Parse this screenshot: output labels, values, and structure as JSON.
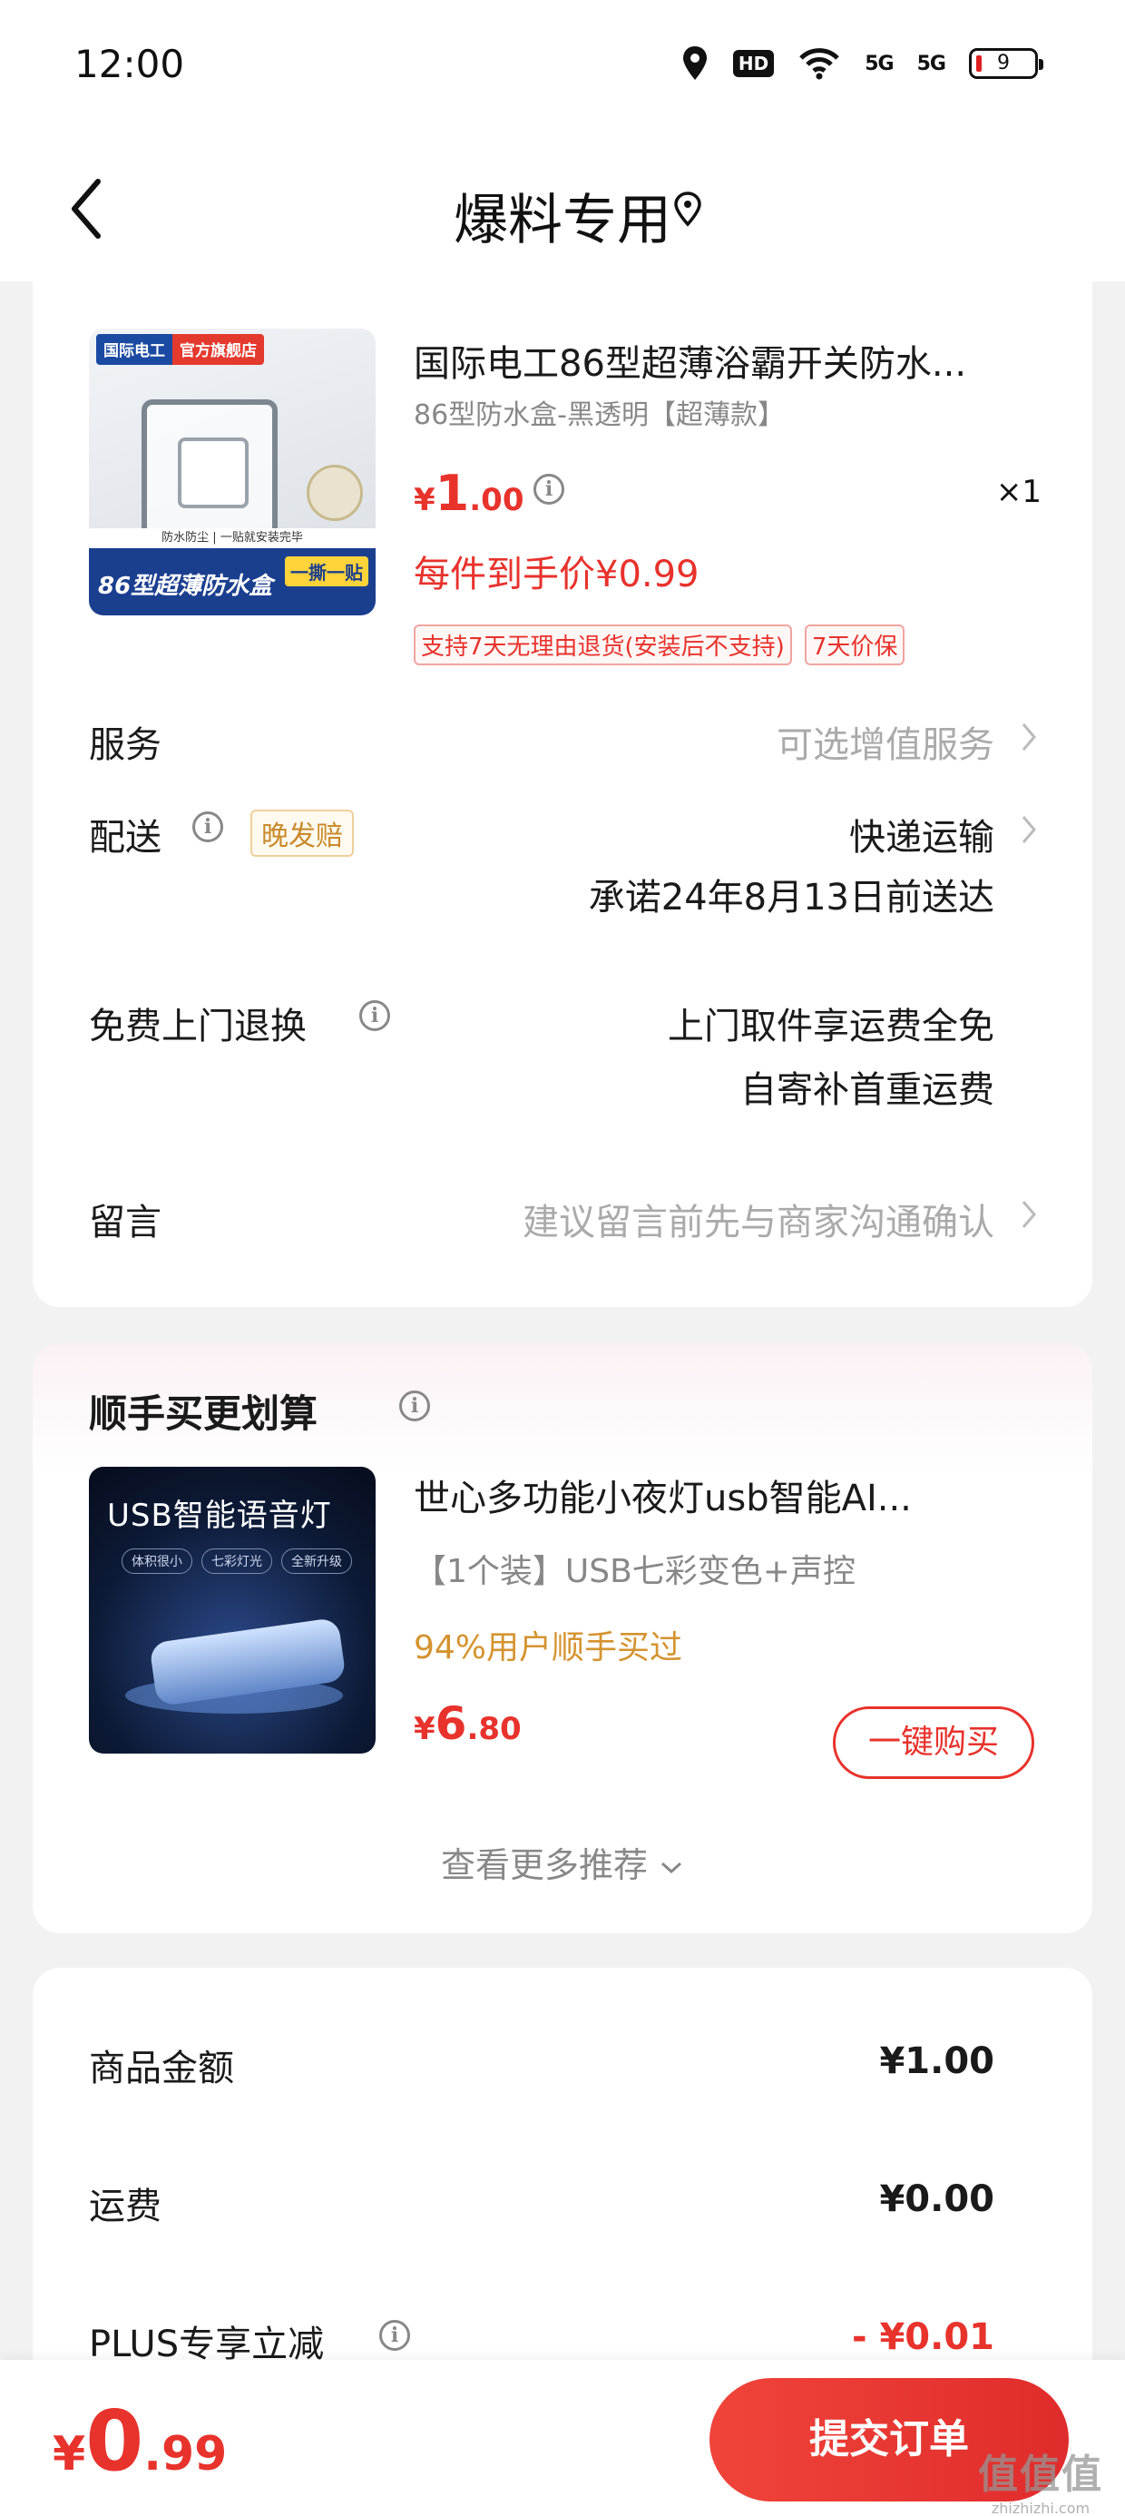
{
  "status_bar": {
    "time": "12:00",
    "icons": [
      "location-icon",
      "hd-icon",
      "wifi-icon",
      "signal-5g-icon",
      "signal-5g-icon",
      "battery-icon"
    ],
    "hd_label": "HD",
    "signal1": "5G",
    "signal2": "5G",
    "battery_level": "9"
  },
  "nav": {
    "title": "爆料专用"
  },
  "product": {
    "image_tag_left": "国际电工",
    "image_tag_right": "官方旗舰店",
    "image_band_top": "防水防尘 | 一贴就安装完毕",
    "image_caption": "86型超薄防水盒",
    "image_caption2": "一撕一贴",
    "title": "国际电工86型超薄浴霸开关防水...",
    "spec": "86型防水盒-黑透明【超薄款】",
    "price_symbol": "¥",
    "price_int": "1",
    "price_dec": ".00",
    "quantity": "×1",
    "unit_price": "每件到手价¥0.99",
    "tags": [
      "支持7天无理由退货(安装后不支持)",
      "7天价保"
    ]
  },
  "rows": {
    "service_label": "服务",
    "service_value": "可选增值服务",
    "delivery_label": "配送",
    "delivery_badge": "晚发赔",
    "delivery_value": "快递运输",
    "delivery_promise": "承诺24年8月13日前送达",
    "return_label": "免费上门退换",
    "return_value1": "上门取件享运费全免",
    "return_value2": "自寄补首重运费",
    "message_label": "留言",
    "message_placeholder": "建议留言前先与商家沟通确认"
  },
  "recommend": {
    "title": "顺手买更划算",
    "image_title": "USB智能语音灯",
    "image_chips": [
      "体积很小",
      "七彩灯光",
      "全新升级"
    ],
    "name": "世心多功能小夜灯usb智能AI...",
    "spec": "【1个装】USB七彩变色+声控",
    "bought": "94%用户顺手买过",
    "price_symbol": "¥",
    "price_int": "6",
    "price_dec": ".80",
    "buy_label": "一键购买",
    "more_label": "查看更多推荐"
  },
  "summary": {
    "goods_label": "商品金额",
    "goods_value": "¥1.00",
    "shipping_label": "运费",
    "shipping_value": "¥0.00",
    "plus_label": "PLUS专享立减",
    "plus_value": "- ¥0.01"
  },
  "bottom": {
    "total_symbol": "¥",
    "total_int": "0",
    "total_dec": ".99",
    "submit_label": "提交订单",
    "watermark": "值值值",
    "watermark_sub": "zhizhizhi.com"
  },
  "colors": {
    "accent": "#e8322c",
    "gold": "#d4932f",
    "muted": "#888888",
    "background": "#f2f2f2"
  }
}
